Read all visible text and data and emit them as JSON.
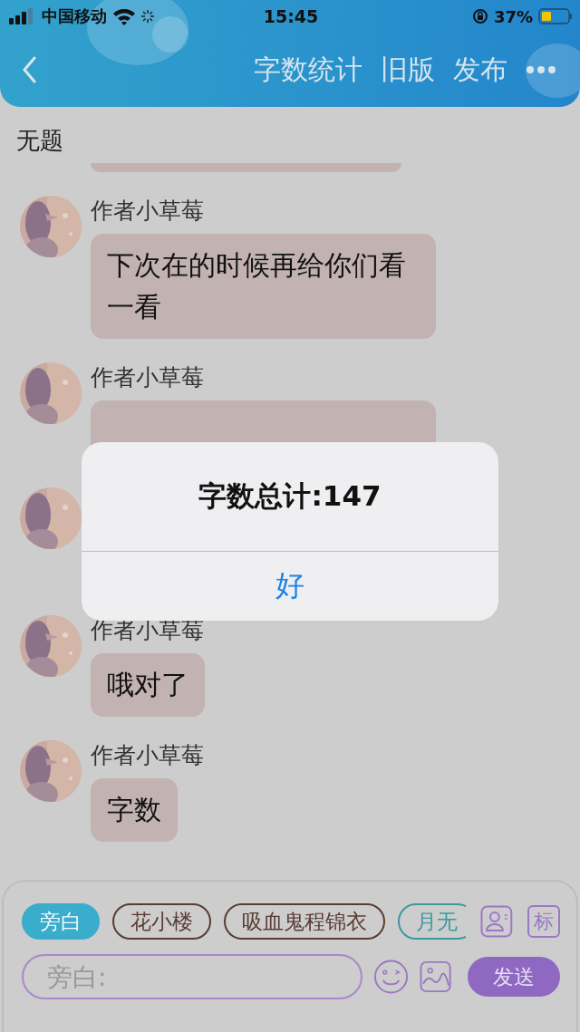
{
  "status_bar": {
    "carrier": "中国移动",
    "time": "15:45",
    "battery": "37%"
  },
  "header": {
    "actions": [
      "字数统计",
      "旧版",
      "发布"
    ]
  },
  "title": "无题",
  "messages": [
    {
      "kind": "text",
      "author": "作者小草莓",
      "text": "下次在的时候再给你们看一看"
    },
    {
      "kind": "covered",
      "author": "作者小草莓"
    },
    {
      "kind": "hidden"
    },
    {
      "kind": "text",
      "author": "作者小草莓",
      "text": "哦对了"
    },
    {
      "kind": "text",
      "author": "作者小草莓",
      "text": "字数"
    }
  ],
  "alert": {
    "title": "字数总计:147",
    "button": "好"
  },
  "roles": [
    {
      "label": "旁白",
      "selected": true,
      "color": "#3aaccc"
    },
    {
      "label": "花小楼",
      "selected": false,
      "color": "#5a3c34"
    },
    {
      "label": "吸血鬼程锦衣",
      "selected": false,
      "color": "#5a3c34"
    },
    {
      "label": "月无",
      "selected": false,
      "color": "#3a9aa0"
    }
  ],
  "tag_button": "标",
  "input": {
    "placeholder": "旁白:"
  },
  "send_button": "发送"
}
